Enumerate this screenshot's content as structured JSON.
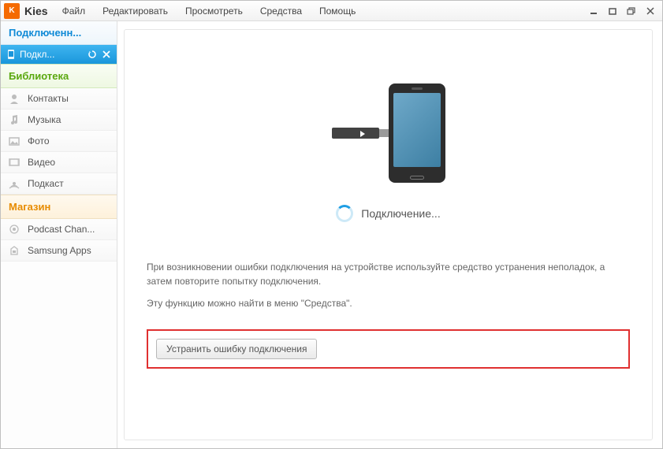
{
  "app": {
    "name_short": "K",
    "title": "Kies"
  },
  "menu": {
    "file": "Файл",
    "edit": "Редактировать",
    "view": "Просмотреть",
    "tools": "Средства",
    "help": "Помощь"
  },
  "sidebar": {
    "connect_hdr": "Подключенн...",
    "device": {
      "label": "Подкл..."
    },
    "library_hdr": "Библиотека",
    "items": [
      {
        "label": "Контакты"
      },
      {
        "label": "Музыка"
      },
      {
        "label": "Фото"
      },
      {
        "label": "Видео"
      },
      {
        "label": "Подкаст"
      }
    ],
    "store_hdr": "Магазин",
    "store_items": [
      {
        "label": "Podcast Chan..."
      },
      {
        "label": "Samsung Apps"
      }
    ]
  },
  "main": {
    "status": "Подключение...",
    "help1": "При возникновении ошибки подключения на устройстве используйте средство устранения неполадок, а затем повторите попытку подключения.",
    "help2": "Эту функцию можно найти в меню \"Средства\".",
    "fix_button": "Устранить ошибку подключения"
  }
}
